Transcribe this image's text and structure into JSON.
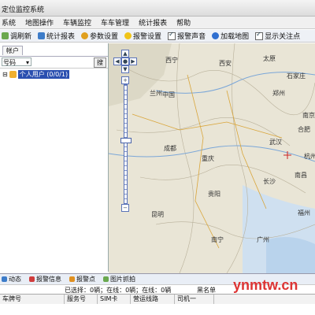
{
  "window": {
    "title": "定位监控系统"
  },
  "menu": [
    "系统",
    "地图操作",
    "车辆监控",
    "车车管理",
    "统计报表",
    "帮助"
  ],
  "toolbar": {
    "items": [
      "调刷新",
      "统计报表",
      "参数设置",
      "报警设置",
      "报警声音",
      "加载地图",
      "显示关注点"
    ],
    "checkboxes_checked": [
      true,
      true
    ]
  },
  "left_panel": {
    "tab": "帐户",
    "search_select": "号码",
    "search_button": "搜",
    "tree_item": "个人用户 (0/0/1)"
  },
  "map": {
    "cities": [
      "西宁",
      "兰州",
      "西安",
      "太原",
      "郑州",
      "石家庄",
      "成都",
      "重庆",
      "武汉",
      "长沙",
      "南昌",
      "合肥",
      "南京",
      "杭州",
      "福州",
      "贵阳",
      "昆明",
      "南宁",
      "广州",
      "中国"
    ],
    "accent": "#cc2222"
  },
  "bottom_tabs": [
    "动态",
    "报警信息",
    "报警点",
    "图片抓拍"
  ],
  "status": {
    "online": "已选择：0辆；在线：0辆；在线：0辆",
    "right": "黑名单"
  },
  "grid_columns": [
    "车牌号",
    "服务号",
    "SIM卡",
    "营运线路",
    "司机一"
  ],
  "watermark": "ynmtw.cn"
}
